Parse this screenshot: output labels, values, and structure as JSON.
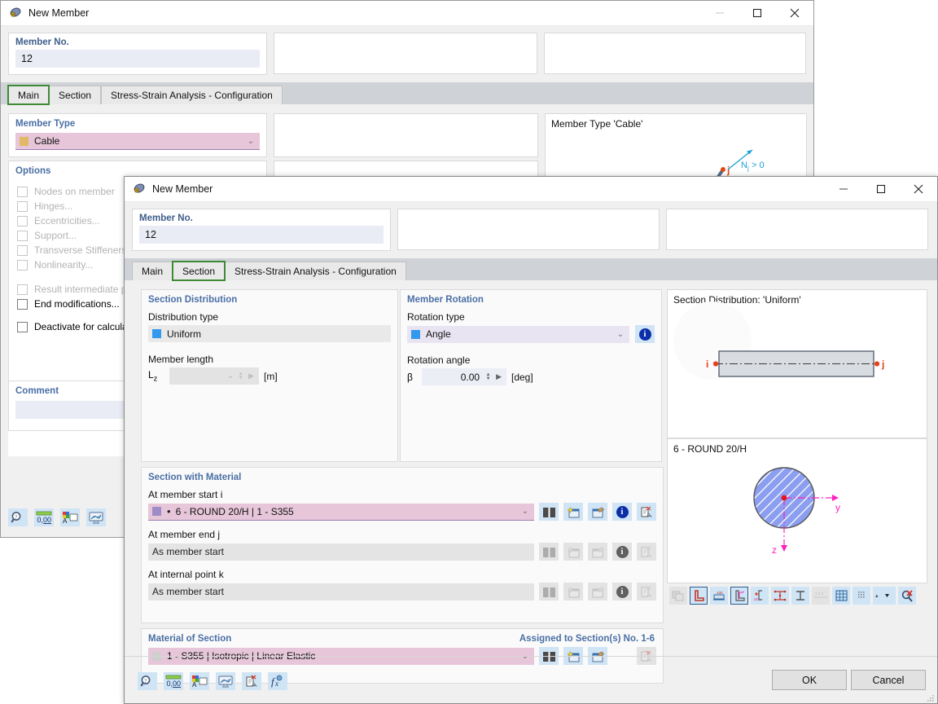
{
  "background_window": {
    "title": "New Member",
    "icon": "member-icon",
    "controls": {
      "minimize": "minimize-icon",
      "maximize": "maximize-icon",
      "close": "close-icon"
    },
    "member_no": {
      "label": "Member No.",
      "value": "12"
    },
    "tabs": [
      {
        "label": "Main",
        "selected": true
      },
      {
        "label": "Section",
        "selected": false
      },
      {
        "label": "Stress-Strain Analysis - Configuration",
        "selected": false
      }
    ],
    "member_type": {
      "title": "Member Type",
      "value": "Cable",
      "swatch": "#e2b866"
    },
    "options": {
      "title": "Options",
      "items": [
        {
          "label": "Nodes on member",
          "disabled": true,
          "checked": false
        },
        {
          "label": "Hinges...",
          "disabled": true,
          "checked": false
        },
        {
          "label": "Eccentricities...",
          "disabled": true,
          "checked": false
        },
        {
          "label": "Support...",
          "disabled": true,
          "checked": false
        },
        {
          "label": "Transverse Stiffeners...",
          "disabled": true,
          "checked": false
        },
        {
          "label": "Nonlinearity...",
          "disabled": true,
          "checked": false
        },
        {
          "label": "Result intermediate p",
          "disabled": true,
          "checked": false
        },
        {
          "label": "End modifications...",
          "disabled": false,
          "checked": false
        },
        {
          "label": "Deactivate for calcula",
          "disabled": false,
          "checked": false
        }
      ]
    },
    "comment": {
      "label": "Comment",
      "value": ""
    },
    "preview": {
      "caption": "Member Type 'Cable'",
      "annotation": "N",
      "annotation_sub": "j",
      "annotation_rest": "> 0",
      "node_label": "j"
    },
    "toolbar": [
      {
        "name": "find-icon"
      },
      {
        "name": "numeric-format-icon"
      },
      {
        "name": "display-properties-icon"
      },
      {
        "name": "render-icon"
      }
    ]
  },
  "front_window": {
    "title": "New Member",
    "icon": "member-icon",
    "controls": {
      "minimize": "minimize-icon",
      "maximize": "maximize-icon",
      "close": "close-icon"
    },
    "member_no": {
      "label": "Member No.",
      "value": "12"
    },
    "tabs": [
      {
        "label": "Main",
        "selected": false
      },
      {
        "label": "Section",
        "selected": true
      },
      {
        "label": "Stress-Strain Analysis - Configuration",
        "selected": false
      }
    ],
    "section_distribution": {
      "title": "Section Distribution",
      "distribution_type_label": "Distribution type",
      "distribution_type_value": "Uniform",
      "distribution_type_swatch": "#3399ee",
      "member_length_label": "Member length",
      "member_length_symbol": "L",
      "member_length_subscript": "z",
      "member_length_value": "",
      "member_length_unit": "[m]"
    },
    "member_rotation": {
      "title": "Member Rotation",
      "rotation_type_label": "Rotation type",
      "rotation_type_value": "Angle",
      "rotation_type_swatch": "#3399ee",
      "info_icon": "info-icon",
      "rotation_angle_label": "Rotation angle",
      "rotation_angle_symbol": "β",
      "rotation_angle_value": "0.00",
      "rotation_angle_unit": "[deg]"
    },
    "section_with_material": {
      "title": "Section with Material",
      "rows": [
        {
          "label": "At member start i",
          "value": "6 - ROUND 20/H | 1 - S355",
          "swatch": "#9e8cc9",
          "bullet": true,
          "state": "active",
          "buttons": [
            {
              "name": "library-icon",
              "enabled": true
            },
            {
              "name": "new-section-icon",
              "enabled": true
            },
            {
              "name": "edit-section-icon",
              "enabled": true
            },
            {
              "name": "info-icon",
              "enabled": true
            },
            {
              "name": "delete-section-icon",
              "enabled": true
            }
          ]
        },
        {
          "label": "At member end j",
          "value": "As member start",
          "swatch": null,
          "bullet": false,
          "state": "disabled",
          "buttons": [
            {
              "name": "library-icon",
              "enabled": false
            },
            {
              "name": "new-section-icon",
              "enabled": false
            },
            {
              "name": "edit-section-icon",
              "enabled": false
            },
            {
              "name": "info-icon",
              "enabled": false
            },
            {
              "name": "delete-section-icon",
              "enabled": false
            }
          ]
        },
        {
          "label": "At internal point k",
          "value": "As member start",
          "swatch": null,
          "bullet": false,
          "state": "disabled",
          "buttons": [
            {
              "name": "library-icon",
              "enabled": false
            },
            {
              "name": "new-section-icon",
              "enabled": false
            },
            {
              "name": "edit-section-icon",
              "enabled": false
            },
            {
              "name": "info-icon",
              "enabled": false
            },
            {
              "name": "delete-section-icon",
              "enabled": false
            }
          ]
        }
      ]
    },
    "material_of_section": {
      "title": "Material of Section",
      "assigned_text": "Assigned to Section(s) No. 1-6",
      "value": "1 - S355 | Isotropic | Linear Elastic",
      "swatch": "#cfcfcf",
      "buttons": [
        {
          "name": "library-icon",
          "enabled": true
        },
        {
          "name": "new-material-icon",
          "enabled": true
        },
        {
          "name": "edit-material-icon",
          "enabled": true
        },
        {
          "name": "delete-material-icon",
          "enabled": false
        }
      ]
    },
    "preview_top": {
      "caption": "Section Distribution: 'Uniform'",
      "node_i": "i",
      "node_j": "j"
    },
    "preview_bottom": {
      "caption": "6 - ROUND 20/H",
      "axis_y": "y",
      "axis_z": "z"
    },
    "preview_toolbar": [
      {
        "name": "section-shape-icon",
        "state": "disabled"
      },
      {
        "name": "section-outline-icon",
        "state": "selected"
      },
      {
        "name": "dimensions-icon",
        "state": "normal"
      },
      {
        "name": "axes-icon",
        "state": "selected"
      },
      {
        "name": "shear-center-icon",
        "state": "normal"
      },
      {
        "name": "stress-points-icon",
        "state": "normal"
      },
      {
        "name": "section-profile-icon",
        "state": "normal"
      },
      {
        "name": "numbering-icon",
        "state": "disabled"
      },
      {
        "name": "grid-icon",
        "state": "normal"
      },
      {
        "name": "mesh-icon",
        "state": "normal"
      },
      {
        "name": "dropdown-icon",
        "state": "normal"
      },
      {
        "name": "zoom-reset-icon",
        "state": "normal"
      }
    ],
    "bottom_toolbar": [
      {
        "name": "find-icon"
      },
      {
        "name": "numeric-format-icon"
      },
      {
        "name": "display-properties-icon"
      },
      {
        "name": "render-icon"
      },
      {
        "name": "delete-icon"
      },
      {
        "name": "formula-icon"
      }
    ],
    "buttons": {
      "ok": "OK",
      "cancel": "Cancel"
    }
  }
}
